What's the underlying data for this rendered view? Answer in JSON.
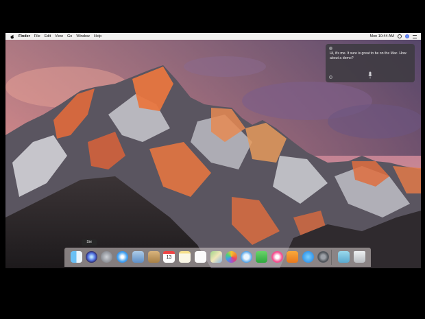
{
  "menubar": {
    "app_name": "Finder",
    "menus": [
      "File",
      "Edit",
      "View",
      "Go",
      "Window",
      "Help"
    ],
    "clock": "Mon 10:44 AM"
  },
  "siri": {
    "message": "Hi, it's me. It sure is great to be on the Mac. How about a demo?",
    "help_glyph": "?"
  },
  "dock": {
    "tooltip": "Siri",
    "calendar_day": "13",
    "apps": [
      "finder-icon",
      "siri-icon",
      "launchpad-icon",
      "safari-icon",
      "mail-icon",
      "contacts-icon",
      "calendar-icon",
      "notes-icon",
      "reminders-icon",
      "maps-icon",
      "photos-icon",
      "messages-icon",
      "facetime-icon",
      "itunes-icon",
      "ibooks-icon",
      "app-store-icon",
      "system-preferences-icon",
      "downloads-icon",
      "trash-icon"
    ]
  },
  "colors": {
    "menubar_bg": "#f1f0ef",
    "siri_panel_bg": "#3c3a40",
    "dock_bg": "#d7cdcd"
  }
}
